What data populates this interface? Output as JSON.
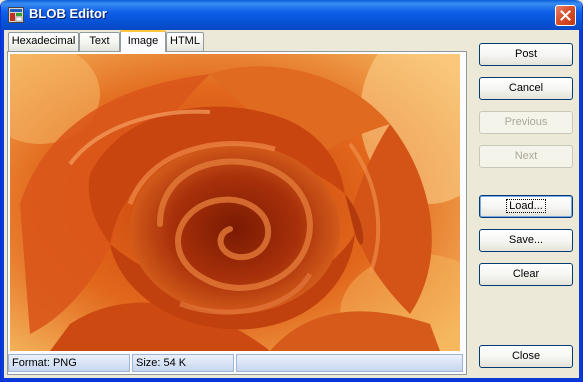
{
  "window": {
    "title": "BLOB Editor"
  },
  "tabs": [
    {
      "label": "Hexadecimal",
      "active": false
    },
    {
      "label": "Text",
      "active": false
    },
    {
      "label": "Image",
      "active": true
    },
    {
      "label": "HTML",
      "active": false
    }
  ],
  "image": {
    "description_icon": "rose-photo"
  },
  "status": {
    "format": "Format: PNG",
    "size": "Size: 54 K",
    "extra": ""
  },
  "buttons": {
    "post": "Post",
    "cancel": "Cancel",
    "previous": "Previous",
    "next": "Next",
    "load": "Load...",
    "save": "Save...",
    "clear": "Clear",
    "close": "Close"
  },
  "colors": {
    "title_bar": "#0a5fd8",
    "active_tab_highlight": "#ffc83c",
    "button_border": "#003c74"
  }
}
